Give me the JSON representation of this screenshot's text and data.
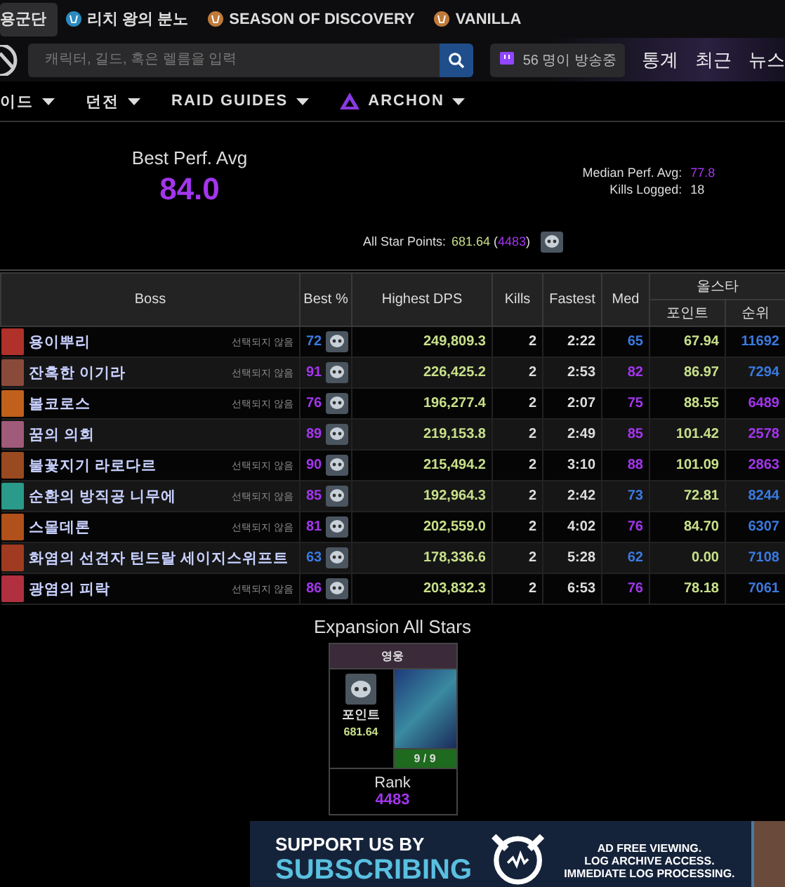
{
  "top_tabs": [
    {
      "label": "용군단",
      "selected": true
    },
    {
      "label": "리치 왕의 분노",
      "selected": false,
      "kind": "blue"
    },
    {
      "label": "SEASON OF DISCOVERY",
      "selected": false,
      "kind": "gold"
    },
    {
      "label": "VANILLA",
      "selected": false,
      "kind": "gold"
    }
  ],
  "search": {
    "placeholder": "캐릭터, 길드, 혹은 렐름을 입력"
  },
  "stream": {
    "label": "56 명이 방송중"
  },
  "header_links": [
    "통계",
    "최근",
    "뉴스"
  ],
  "nav": [
    {
      "label": "이드",
      "logo": false
    },
    {
      "label": "던전",
      "logo": false
    },
    {
      "label": "RAID GUIDES",
      "logo": false
    },
    {
      "label": "ARCHON",
      "logo": true
    }
  ],
  "summary": {
    "best_label": "Best Perf. Avg",
    "best_value": "84.0",
    "median_label": "Median Perf. Avg:",
    "median_value": "77.8",
    "kills_label": "Kills Logged:",
    "kills_value": "18",
    "star_label": "All Star Points:",
    "star_points": "681.64",
    "star_open": "(",
    "star_rank": "4483",
    "star_close": ")"
  },
  "table": {
    "columns": [
      "Boss",
      "Best %",
      "Highest DPS",
      "Kills",
      "Fastest",
      "Med"
    ],
    "group": "올스타",
    "subcolumns": [
      "포인트",
      "순위"
    ],
    "rows": [
      {
        "boss": "용이뿌리",
        "tag": "선택되지 않음",
        "portrait": {
          "color": "#b0302a"
        },
        "best": {
          "value": "72",
          "color": "#3a7ae0"
        },
        "dps": "249,809.3",
        "kills": "2",
        "fastest": "2:22",
        "med": {
          "value": "65",
          "color": "#3a7ae0"
        },
        "points": "67.94",
        "rank": {
          "value": "11692",
          "color": "#3a7ae0"
        }
      },
      {
        "boss": "잔혹한 이기라",
        "tag": "선택되지 않음",
        "portrait": {
          "color": "#8a4a3a"
        },
        "best": {
          "value": "91",
          "color": "#a335ee"
        },
        "dps": "226,425.2",
        "kills": "2",
        "fastest": "2:53",
        "med": {
          "value": "82",
          "color": "#a335ee"
        },
        "points": "86.97",
        "rank": {
          "value": "7294",
          "color": "#3a7ae0"
        }
      },
      {
        "boss": "볼코로스",
        "tag": "선택되지 않음",
        "portrait": {
          "color": "#c0601a"
        },
        "best": {
          "value": "76",
          "color": "#a335ee"
        },
        "dps": "196,277.4",
        "kills": "2",
        "fastest": "2:07",
        "med": {
          "value": "75",
          "color": "#a335ee"
        },
        "points": "88.55",
        "rank": {
          "value": "6489",
          "color": "#a335ee"
        }
      },
      {
        "boss": "꿈의 의회",
        "portrait": {
          "color": "#a05a7a"
        },
        "best": {
          "value": "89",
          "color": "#a335ee"
        },
        "dps": "219,153.8",
        "kills": "2",
        "fastest": "2:49",
        "med": {
          "value": "85",
          "color": "#a335ee"
        },
        "points": "101.42",
        "rank": {
          "value": "2578",
          "color": "#a335ee"
        }
      },
      {
        "boss": "불꽃지기 라로다르",
        "tag": "선택되지 않음",
        "portrait": {
          "color": "#9a4a20"
        },
        "best": {
          "value": "90",
          "color": "#a335ee"
        },
        "dps": "215,494.2",
        "kills": "2",
        "fastest": "3:10",
        "med": {
          "value": "88",
          "color": "#a335ee"
        },
        "points": "101.09",
        "rank": {
          "value": "2863",
          "color": "#a335ee"
        }
      },
      {
        "boss": "순환의 방직공 니무에",
        "tag": "선택되지 않음",
        "portrait": {
          "color": "#2a9a8a"
        },
        "best": {
          "value": "85",
          "color": "#a335ee"
        },
        "dps": "192,964.3",
        "kills": "2",
        "fastest": "2:42",
        "med": {
          "value": "73",
          "color": "#3a7ae0"
        },
        "points": "72.81",
        "rank": {
          "value": "8244",
          "color": "#3a7ae0"
        }
      },
      {
        "boss": "스몰데론",
        "tag": "선택되지 않음",
        "portrait": {
          "color": "#b0501a"
        },
        "best": {
          "value": "81",
          "color": "#a335ee"
        },
        "dps": "202,559.0",
        "kills": "2",
        "fastest": "4:02",
        "med": {
          "value": "76",
          "color": "#a335ee"
        },
        "points": "84.70",
        "rank": {
          "value": "6307",
          "color": "#3a7ae0"
        }
      },
      {
        "boss": "화염의 선견자 틴드랄 세이지스위프트",
        "portrait": {
          "color": "#a03a20"
        },
        "best": {
          "value": "63",
          "color": "#3a7ae0"
        },
        "dps": "178,336.6",
        "kills": "2",
        "fastest": "5:28",
        "med": {
          "value": "62",
          "color": "#3a7ae0"
        },
        "points": "0.00",
        "rank": {
          "value": "7108",
          "color": "#3a7ae0"
        }
      },
      {
        "boss": "광염의 피락",
        "tag": "선택되지 않음",
        "portrait": {
          "color": "#b03040"
        },
        "best": {
          "value": "86",
          "color": "#a335ee"
        },
        "dps": "203,832.3",
        "kills": "2",
        "fastest": "6:53",
        "med": {
          "value": "76",
          "color": "#a335ee"
        },
        "points": "78.18",
        "rank": {
          "value": "7061",
          "color": "#3a7ae0"
        }
      }
    ]
  },
  "expansion": {
    "title": "Expansion All Stars",
    "difficulty": "영웅",
    "points_label": "포인트",
    "points": "681.64",
    "progress": "9 / 9",
    "rank_label": "Rank",
    "rank": "4483"
  },
  "banner": {
    "line1": "SUPPORT US BY",
    "line2": "SUBSCRIBING",
    "perks": [
      "AD FREE VIEWING.",
      "LOG ARCHIVE ACCESS.",
      "IMMEDIATE LOG PROCESSING."
    ]
  }
}
